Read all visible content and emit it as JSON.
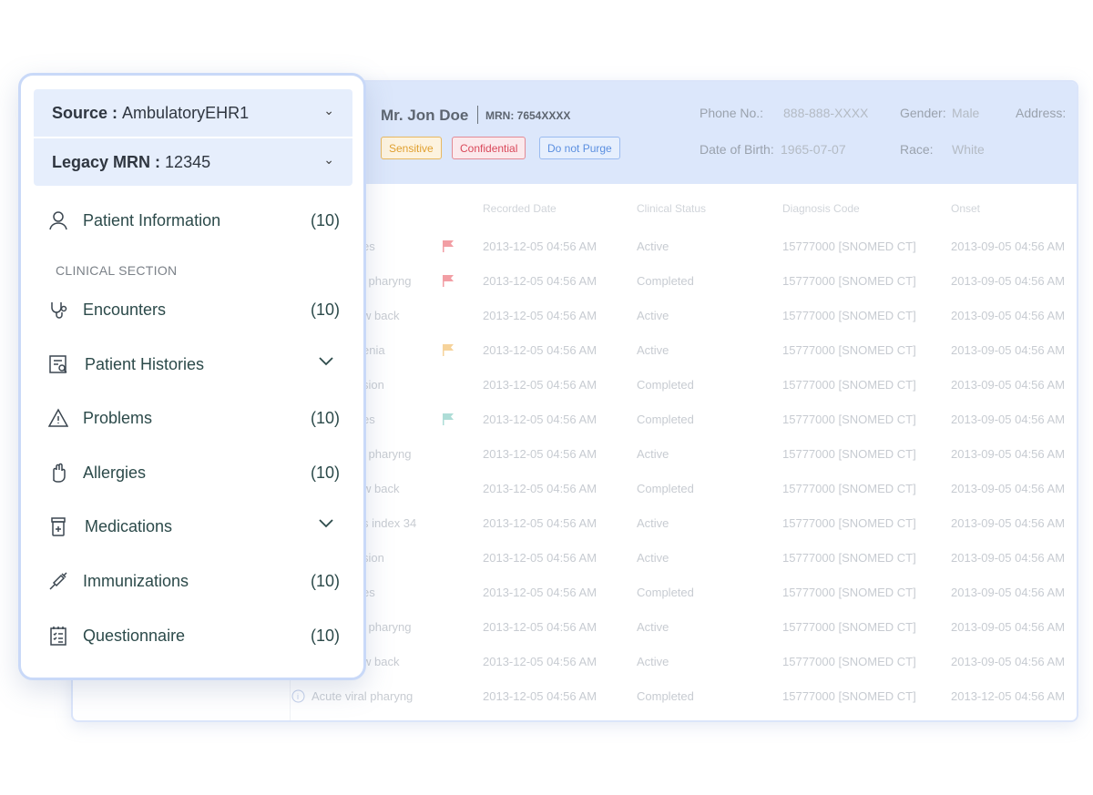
{
  "patient": {
    "name": "Mr. Jon Doe",
    "mrn": "MRN: 7654XXXX",
    "phone_label": "Phone No.:",
    "phone": "888-888-XXXX",
    "gender_label": "Gender:",
    "gender": "Male",
    "address_label": "Address:",
    "dob_label": "Date of Birth:",
    "dob": "1965-07-07",
    "race_label": "Race:",
    "race": "White",
    "badges": [
      {
        "label": "Sensitive",
        "color": "#e0a030"
      },
      {
        "label": "Confidential",
        "color": "#d9485a"
      },
      {
        "label": "Do not Purge",
        "color": "#5b8fe0"
      }
    ]
  },
  "table": {
    "headers": [
      "Recorded Date",
      "Clinical Status",
      "Diagnosis Code",
      "Onset"
    ],
    "rows": [
      {
        "name": "es",
        "date": "2013-12-05 04:56 AM",
        "status": "Active",
        "code": "15777000 [SNOMED CT]",
        "onset": "2013-09-05 04:56 AM",
        "flag": "#e8505b"
      },
      {
        "name": "l pharyng",
        "date": "2013-12-05 04:56 AM",
        "status": "Completed",
        "code": "15777000 [SNOMED CT]",
        "onset": "2013-09-05 04:56 AM",
        "flag": "#e8505b"
      },
      {
        "name": "w back",
        "date": "2013-12-05 04:56 AM",
        "status": "Active",
        "code": "15777000 [SNOMED CT]",
        "onset": "2013-09-05 04:56 AM"
      },
      {
        "name": "enia",
        "date": "2013-12-05 04:56 AM",
        "status": "Active",
        "code": "15777000 [SNOMED CT]",
        "onset": "2013-09-05 04:56 AM",
        "flag": "#f0b04a"
      },
      {
        "name": "sion",
        "date": "2013-12-05 04:56 AM",
        "status": "Completed",
        "code": "15777000 [SNOMED CT]",
        "onset": "2013-09-05 04:56 AM"
      },
      {
        "name": "es",
        "date": "2013-12-05 04:56 AM",
        "status": "Completed",
        "code": "15777000 [SNOMED CT]",
        "onset": "2013-09-05 04:56 AM",
        "flag": "#6cc3b8"
      },
      {
        "name": "l pharyng",
        "date": "2013-12-05 04:56 AM",
        "status": "Active",
        "code": "15777000 [SNOMED CT]",
        "onset": "2013-09-05 04:56 AM"
      },
      {
        "name": "w back",
        "date": "2013-12-05 04:56 AM",
        "status": "Completed",
        "code": "15777000 [SNOMED CT]",
        "onset": "2013-09-05 04:56 AM"
      },
      {
        "name": "s index 34",
        "date": "2013-12-05 04:56 AM",
        "status": "Active",
        "code": "15777000 [SNOMED CT]",
        "onset": "2013-09-05 04:56 AM"
      },
      {
        "name": "sion",
        "date": "2013-12-05 04:56 AM",
        "status": "Active",
        "code": "15777000 [SNOMED CT]",
        "onset": "2013-09-05 04:56 AM"
      },
      {
        "name": "es",
        "date": "2013-12-05 04:56 AM",
        "status": "Completed",
        "code": "15777000 [SNOMED CT]",
        "onset": "2013-09-05 04:56 AM"
      },
      {
        "name": "l pharyng",
        "date": "2013-12-05 04:56 AM",
        "status": "Active",
        "code": "15777000 [SNOMED CT]",
        "onset": "2013-09-05 04:56 AM"
      },
      {
        "name": "w back",
        "date": "2013-12-05 04:56 AM",
        "status": "Active",
        "code": "15777000 [SNOMED CT]",
        "onset": "2013-09-05 04:56 AM"
      },
      {
        "name": "Acute viral pharyng",
        "date": "2013-12-05 04:56 AM",
        "status": "Completed",
        "code": "15777000 [SNOMED CT]",
        "onset": "2013-12-05 04:56 AM",
        "info": true
      }
    ]
  },
  "panel": {
    "source_label": "Source :",
    "source": "AmbulatoryEHR1",
    "legacy_label": "Legacy MRN :",
    "legacy": "12345",
    "section": "CLINICAL SECTION",
    "items": [
      {
        "label": "Patient Information",
        "count": "(10)",
        "icon": "user-icon"
      },
      {
        "label": "Encounters",
        "count": "(10)",
        "icon": "stethoscope-icon"
      },
      {
        "label": "Patient Histories",
        "icon": "history-report-icon",
        "expand": true
      },
      {
        "label": "Problems",
        "count": "(10)",
        "icon": "warning-icon"
      },
      {
        "label": "Allergies",
        "count": "(10)",
        "icon": "hand-icon"
      },
      {
        "label": "Medications",
        "icon": "medicine-bottle-icon",
        "expand": true
      },
      {
        "label": "Immunizations",
        "count": "(10)",
        "icon": "syringe-icon"
      },
      {
        "label": "Questionnaire",
        "count": "(10)",
        "icon": "checklist-icon"
      }
    ]
  }
}
